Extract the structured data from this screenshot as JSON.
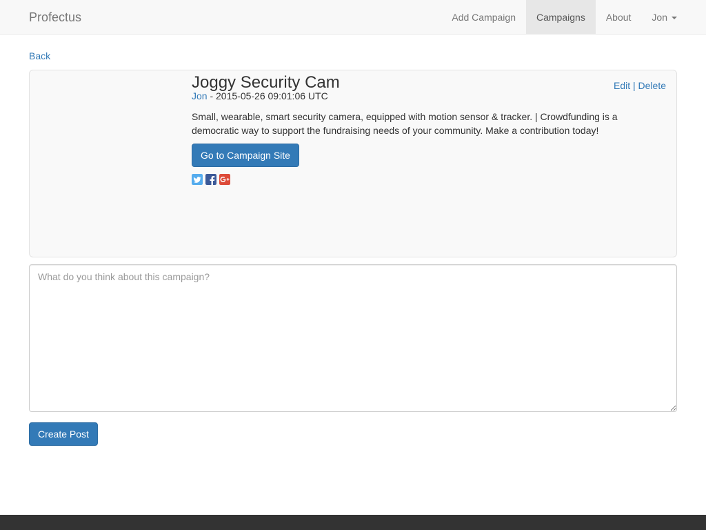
{
  "navbar": {
    "brand": "Profectus",
    "items": [
      {
        "label": "Add Campaign",
        "active": false
      },
      {
        "label": "Campaigns",
        "active": true
      },
      {
        "label": "About",
        "active": false
      },
      {
        "label": "Jon",
        "active": false,
        "dropdown": true
      }
    ]
  },
  "back_label": "Back",
  "campaign": {
    "title": "Joggy Security Cam",
    "author": "Jon",
    "timestamp_text": " - 2015-05-26 09:01:06 UTC",
    "edit_label": "Edit",
    "separator": " | ",
    "delete_label": "Delete",
    "description": "Small, wearable, smart security camera, equipped with motion sensor & tracker. | Crowdfunding is a democratic way to support the fundraising needs of your community. Make a contribution today!",
    "site_button_label": "Go to Campaign Site",
    "share": [
      {
        "icon": "twitter-icon",
        "color": "#55acee"
      },
      {
        "icon": "facebook-icon",
        "color": "#3b5998"
      },
      {
        "icon": "google-plus-icon",
        "color": "#dd4b39"
      }
    ]
  },
  "comment": {
    "placeholder": "What do you think about this campaign?",
    "value": "",
    "submit_label": "Create Post"
  },
  "colors": {
    "link": "#337ab7",
    "primary_button": "#337ab7",
    "navbar_bg": "#f8f8f8",
    "nav_active_bg": "#e7e7e7",
    "well_bg": "#f9f9f9",
    "footer_bg": "#333333"
  }
}
